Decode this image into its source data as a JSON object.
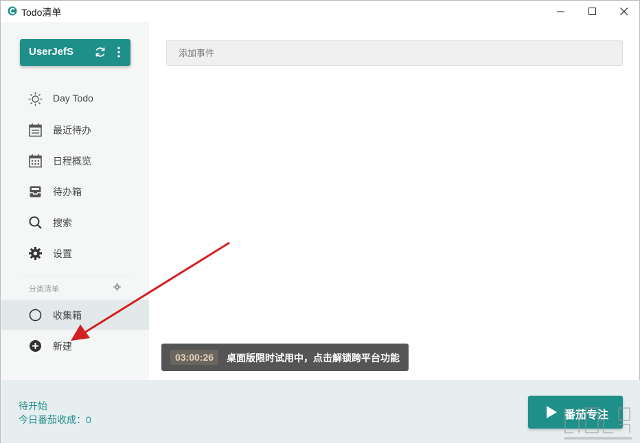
{
  "window": {
    "title": "Todo清单"
  },
  "sidebar": {
    "user_name": "UserJefS",
    "nav": [
      {
        "label": "Day Todo",
        "icon": "sun-icon"
      },
      {
        "label": "最近待办",
        "icon": "calendar-list-icon"
      },
      {
        "label": "日程概览",
        "icon": "calendar-grid-icon"
      },
      {
        "label": "待办箱",
        "icon": "inbox-icon"
      },
      {
        "label": "搜索",
        "icon": "search-icon"
      },
      {
        "label": "设置",
        "icon": "gear-icon"
      }
    ],
    "section_title": "分类清单",
    "lists": [
      {
        "label": "收集箱",
        "icon": "circle-icon",
        "selected": true
      },
      {
        "label": "新建",
        "icon": "plus-circle-icon"
      }
    ]
  },
  "main": {
    "add_placeholder": "添加事件"
  },
  "toast": {
    "time": "03:00:26",
    "message": "桌面版限时试用中，点击解锁跨平台功能"
  },
  "footer": {
    "status": "待开始",
    "tomato_count": "今日番茄收成：0",
    "focus_button": "番茄专注"
  },
  "colors": {
    "accent": "#1f8f8a",
    "sidebar_bg": "#f5f7f7",
    "footer_bg": "#e7eef0",
    "annotation_arrow": "#d42020"
  }
}
